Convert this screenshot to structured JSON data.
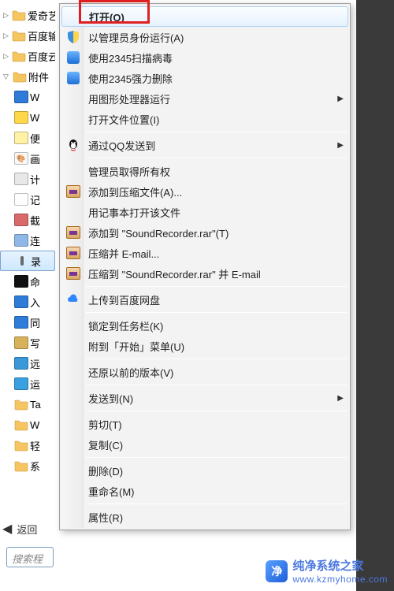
{
  "sidebar": {
    "items": [
      {
        "label": "爱奇艺",
        "type": "folder",
        "expander": "▷"
      },
      {
        "label": "百度输",
        "type": "folder",
        "expander": "▷"
      },
      {
        "label": "百度云",
        "type": "folder",
        "expander": "▷"
      },
      {
        "label": "附件",
        "type": "folder",
        "expander": "▽"
      },
      {
        "label": "W",
        "type": "link-blue",
        "lvl": 2
      },
      {
        "label": "W",
        "type": "window",
        "lvl": 2
      },
      {
        "label": "便",
        "type": "note",
        "lvl": 2
      },
      {
        "label": "画",
        "type": "paint",
        "lvl": 2
      },
      {
        "label": "计",
        "type": "calc",
        "lvl": 2
      },
      {
        "label": "记",
        "type": "notepad",
        "lvl": 2
      },
      {
        "label": "截",
        "type": "snip",
        "lvl": 2
      },
      {
        "label": "连",
        "type": "connect",
        "lvl": 2
      },
      {
        "label": "录",
        "type": "recorder",
        "lvl": 2,
        "selected": true
      },
      {
        "label": "命",
        "type": "cmd",
        "lvl": 2
      },
      {
        "label": "入",
        "type": "link-blue",
        "lvl": 2
      },
      {
        "label": "同",
        "type": "sync",
        "lvl": 2
      },
      {
        "label": "写",
        "type": "write",
        "lvl": 2
      },
      {
        "label": "远",
        "type": "remote",
        "lvl": 2
      },
      {
        "label": "运",
        "type": "run",
        "lvl": 2
      },
      {
        "label": "Ta",
        "type": "folder",
        "lvl": 2
      },
      {
        "label": "W",
        "type": "folder",
        "lvl": 2
      },
      {
        "label": "轻",
        "type": "folder",
        "lvl": 2
      },
      {
        "label": "系",
        "type": "folder",
        "lvl": 2
      }
    ],
    "back_label": "返回",
    "search_placeholder": "搜索程"
  },
  "menu": {
    "items": [
      {
        "label": "打开(O)",
        "icon": "",
        "bold": true,
        "hl": true
      },
      {
        "label": "以管理员身份运行(A)",
        "icon": "shield"
      },
      {
        "label": "使用2345扫描病毒",
        "icon": "scan-blue"
      },
      {
        "label": "使用2345强力删除",
        "icon": "scan-blue-del"
      },
      {
        "label": "用图形处理器运行",
        "icon": "",
        "submenu": true
      },
      {
        "label": "打开文件位置(I)",
        "icon": ""
      },
      {
        "sep": true
      },
      {
        "label": "通过QQ发送到",
        "icon": "qq",
        "submenu": true
      },
      {
        "sep": true
      },
      {
        "label": "管理员取得所有权",
        "icon": ""
      },
      {
        "label": "添加到压缩文件(A)...",
        "icon": "winrar"
      },
      {
        "label": "用记事本打开该文件",
        "icon": ""
      },
      {
        "label": "添加到 \"SoundRecorder.rar\"(T)",
        "icon": "winrar"
      },
      {
        "label": "压缩并 E-mail...",
        "icon": "winrar"
      },
      {
        "label": "压缩到 \"SoundRecorder.rar\" 并 E-mail",
        "icon": "winrar"
      },
      {
        "sep": true
      },
      {
        "label": "上传到百度网盘",
        "icon": "baidu-cloud"
      },
      {
        "sep": true
      },
      {
        "label": "锁定到任务栏(K)",
        "icon": ""
      },
      {
        "label": "附到「开始」菜单(U)",
        "icon": ""
      },
      {
        "sep": true
      },
      {
        "label": "还原以前的版本(V)",
        "icon": ""
      },
      {
        "sep": true
      },
      {
        "label": "发送到(N)",
        "icon": "",
        "submenu": true
      },
      {
        "sep": true
      },
      {
        "label": "剪切(T)",
        "icon": ""
      },
      {
        "label": "复制(C)",
        "icon": ""
      },
      {
        "sep": true
      },
      {
        "label": "删除(D)",
        "icon": ""
      },
      {
        "label": "重命名(M)",
        "icon": ""
      },
      {
        "sep": true
      },
      {
        "label": "属性(R)",
        "icon": ""
      }
    ]
  },
  "watermark": {
    "brand": "纯净系统之家",
    "url": "www.kzmyhome.com"
  }
}
